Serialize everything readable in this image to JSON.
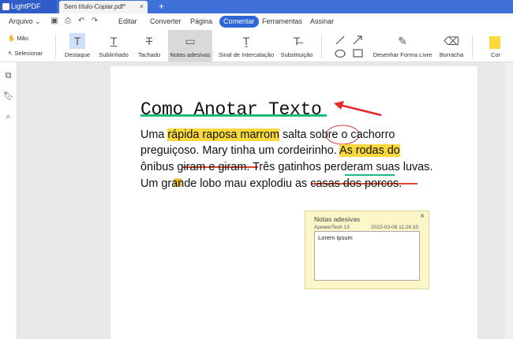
{
  "titlebar": {
    "app_name": "LightPDF",
    "doc_tab": "Sem título-Copiar.pdf*",
    "close": "×",
    "new_tab": "+"
  },
  "menu": {
    "file": "Arquivo",
    "items": [
      "Editar",
      "Converter",
      "Página",
      "Comentar",
      "Ferramentas",
      "Assinar"
    ],
    "active": "Comentar"
  },
  "toolbar": {
    "hand": "Mão",
    "select": "Selecionar",
    "tools": [
      "Destaque",
      "Sublinhado",
      "Tachado",
      "Notas adesivas",
      "Sinal de Intercalação",
      "Substituição",
      "Desenhar Forma Livre",
      "Borracha",
      "Cor"
    ],
    "selected": "Notas adesivas",
    "color": "#fbd93d"
  },
  "document": {
    "heading": "Como Anotar Texto",
    "lines": [
      [
        "Uma ",
        "rápida raposa marrom",
        " salta ",
        "sobre",
        " o cachorro"
      ],
      [
        "preguiçoso. Mary tinha um cordeirinho. ",
        "As rodas do"
      ],
      [
        "ônibus ",
        "giram e giram",
        ". Três gatinhos  ",
        "perderam",
        " suas luvas."
      ],
      [
        "Um gr",
        "a",
        "nde lobo mau explodiu ",
        "as casas dos porcos",
        "."
      ]
    ]
  },
  "sticky_note": {
    "title": "Notas adesivas",
    "close": "×",
    "author": "ApowerTech 13",
    "date": "2022-03-08 11:26:33",
    "content": "Lorem Ipsum"
  },
  "colors": {
    "brand": "#3f6fd8",
    "highlight": "#fbd93d",
    "underline": "#1fb97a",
    "strike": "#e0492a",
    "arrow": "#e32b2b"
  }
}
